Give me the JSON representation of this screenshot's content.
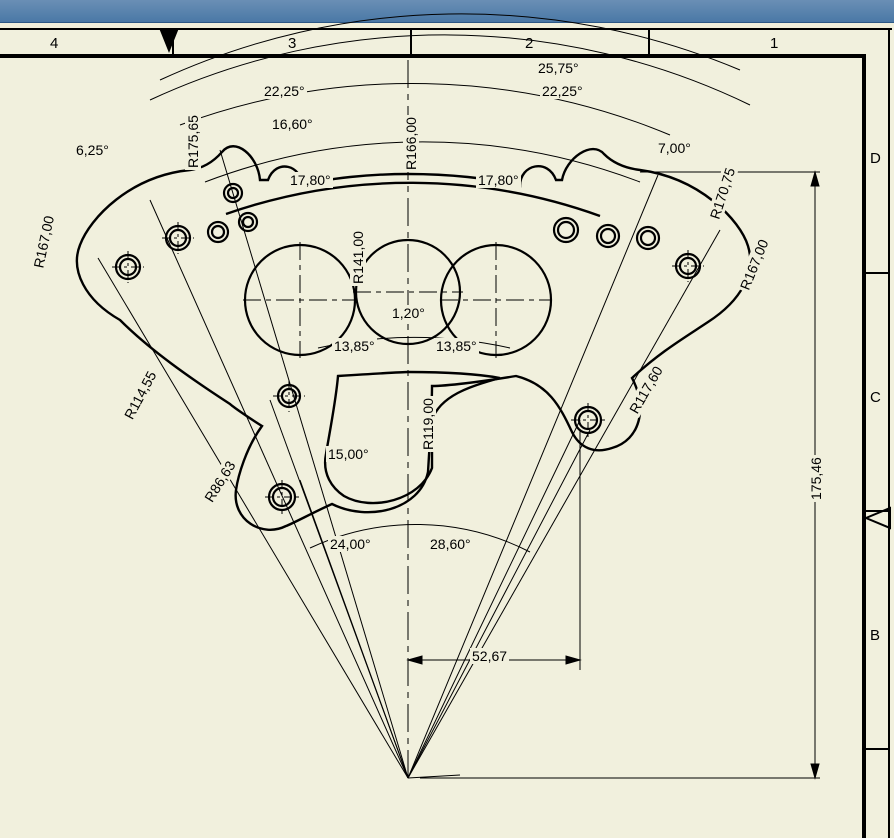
{
  "ruler": {
    "columns": [
      "4",
      "3",
      "2",
      "1"
    ],
    "rows": [
      "D",
      "C",
      "B"
    ]
  },
  "dimensions": {
    "ang_25_75": "25,75°",
    "ang_22_25_L": "22,25°",
    "ang_22_25_R": "22,25°",
    "ang_16_60": "16,60°",
    "ang_7_00": "7,00°",
    "ang_6_25": "6,25°",
    "ang_17_80_L": "17,80°",
    "ang_17_80_R": "17,80°",
    "r166": "R166,00",
    "r175_65": "R175,65",
    "r170_75": "R170,75",
    "r167_L": "R167,00",
    "r167_R": "R167,00",
    "r141": "R141,00",
    "ang_1_20": "1,20°",
    "ang_13_85_L": "13,85°",
    "ang_13_85_R": "13,85°",
    "r114_55": "R114,55",
    "r117_60": "R117,60",
    "r119": "R119,00",
    "ang_15_00": "15,00°",
    "r86_63": "R86,63",
    "ang_24_00": "24,00°",
    "ang_28_60": "28,60°",
    "lin_52_67": "52,67",
    "lin_175_46": "175,46"
  }
}
